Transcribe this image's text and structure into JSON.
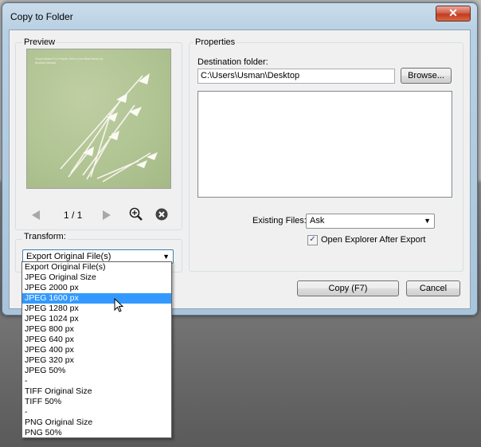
{
  "window": {
    "title": "Copy to Folder",
    "close_glyph": "✕"
  },
  "preview": {
    "label": "Preview",
    "cover_caption": "Good News For People Who Love Bad News by Modest Mouse",
    "page_indicator": "1 / 1",
    "icons": {
      "prev": "arrow-left-icon",
      "next": "arrow-right-icon",
      "zoom": "zoom-in-icon",
      "remove": "remove-icon"
    }
  },
  "transform": {
    "label": "Transform:",
    "selected": "Export Original File(s)",
    "options": [
      "Export Original File(s)",
      "JPEG Original Size",
      "JPEG 2000 px",
      "JPEG 1600 px",
      "JPEG 1280 px",
      "JPEG 1024 px",
      "JPEG 800 px",
      "JPEG 640 px",
      "JPEG 400 px",
      "JPEG 320 px",
      "JPEG 50%",
      "-",
      "TIFF Original Size",
      "TIFF 50%",
      "-",
      "PNG Original Size",
      "PNG 50%"
    ],
    "highlighted": "JPEG 1600 px"
  },
  "properties": {
    "label": "Properties",
    "destination_label": "Destination folder:",
    "destination_value": "C:\\Users\\Usman\\Desktop",
    "browse_label": "Browse...",
    "existing_files_label": "Existing Files:",
    "existing_files_value": "Ask",
    "open_explorer_label": "Open Explorer After Export",
    "open_explorer_checked": true
  },
  "buttons": {
    "copy_label": "Copy (F7)",
    "cancel_label": "Cancel"
  },
  "colors": {
    "selection": "#3399ff",
    "close_button": "#c23a1f",
    "cover_bg": "#b1c493"
  }
}
